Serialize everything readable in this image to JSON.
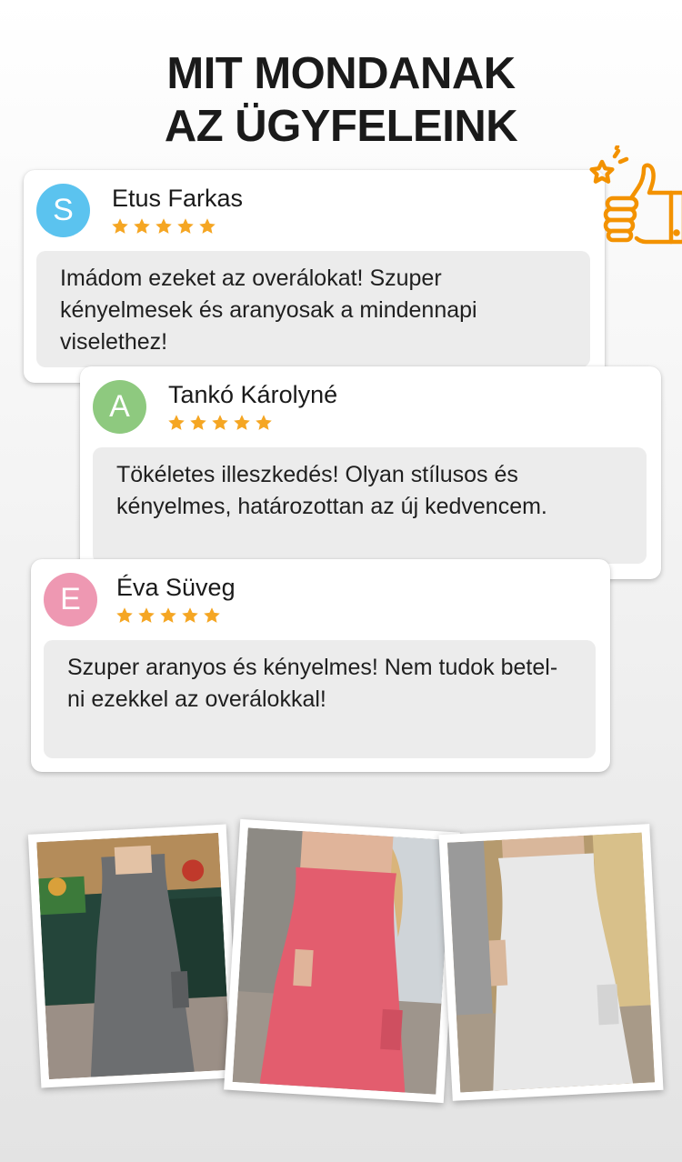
{
  "heading": {
    "line1": "MIT MONDANAK",
    "line2": "AZ ÜGYFELEINK"
  },
  "rating_max": 5,
  "reviews": [
    {
      "initial": "S",
      "avatar_color": "#5bc3ef",
      "name": "Etus Farkas",
      "rating": 5,
      "text": "Imádom ezeket az overálokat! Szuper kényelmesek és aranyosak a mindennapi viselethez!"
    },
    {
      "initial": "A",
      "avatar_color": "#8ec97f",
      "name": "Tankó Károlyné",
      "rating": 5,
      "text": "Tökéletes illeszkedés! Olyan stílusos és kényelmes, határozottan az új kedvencem."
    },
    {
      "initial": "E",
      "avatar_color": "#ee98b2",
      "name": "Éva Süveg",
      "rating": 5,
      "text": "Szuper aranyos és kényelmes! Nem tudok betel-ni ezekkel az overálokkal!"
    }
  ],
  "colors": {
    "star": "#f5a623",
    "accent": "#f39200"
  },
  "icons": {
    "badge": "thumbs-up-star-icon"
  },
  "photos": [
    {
      "subject": "grey-jumpsuit-photo",
      "dress_color": "#6c6e70"
    },
    {
      "subject": "pink-jumpsuit-photo",
      "dress_color": "#e35d6e"
    },
    {
      "subject": "white-jumpsuit-photo",
      "dress_color": "#e8e8e8"
    }
  ]
}
